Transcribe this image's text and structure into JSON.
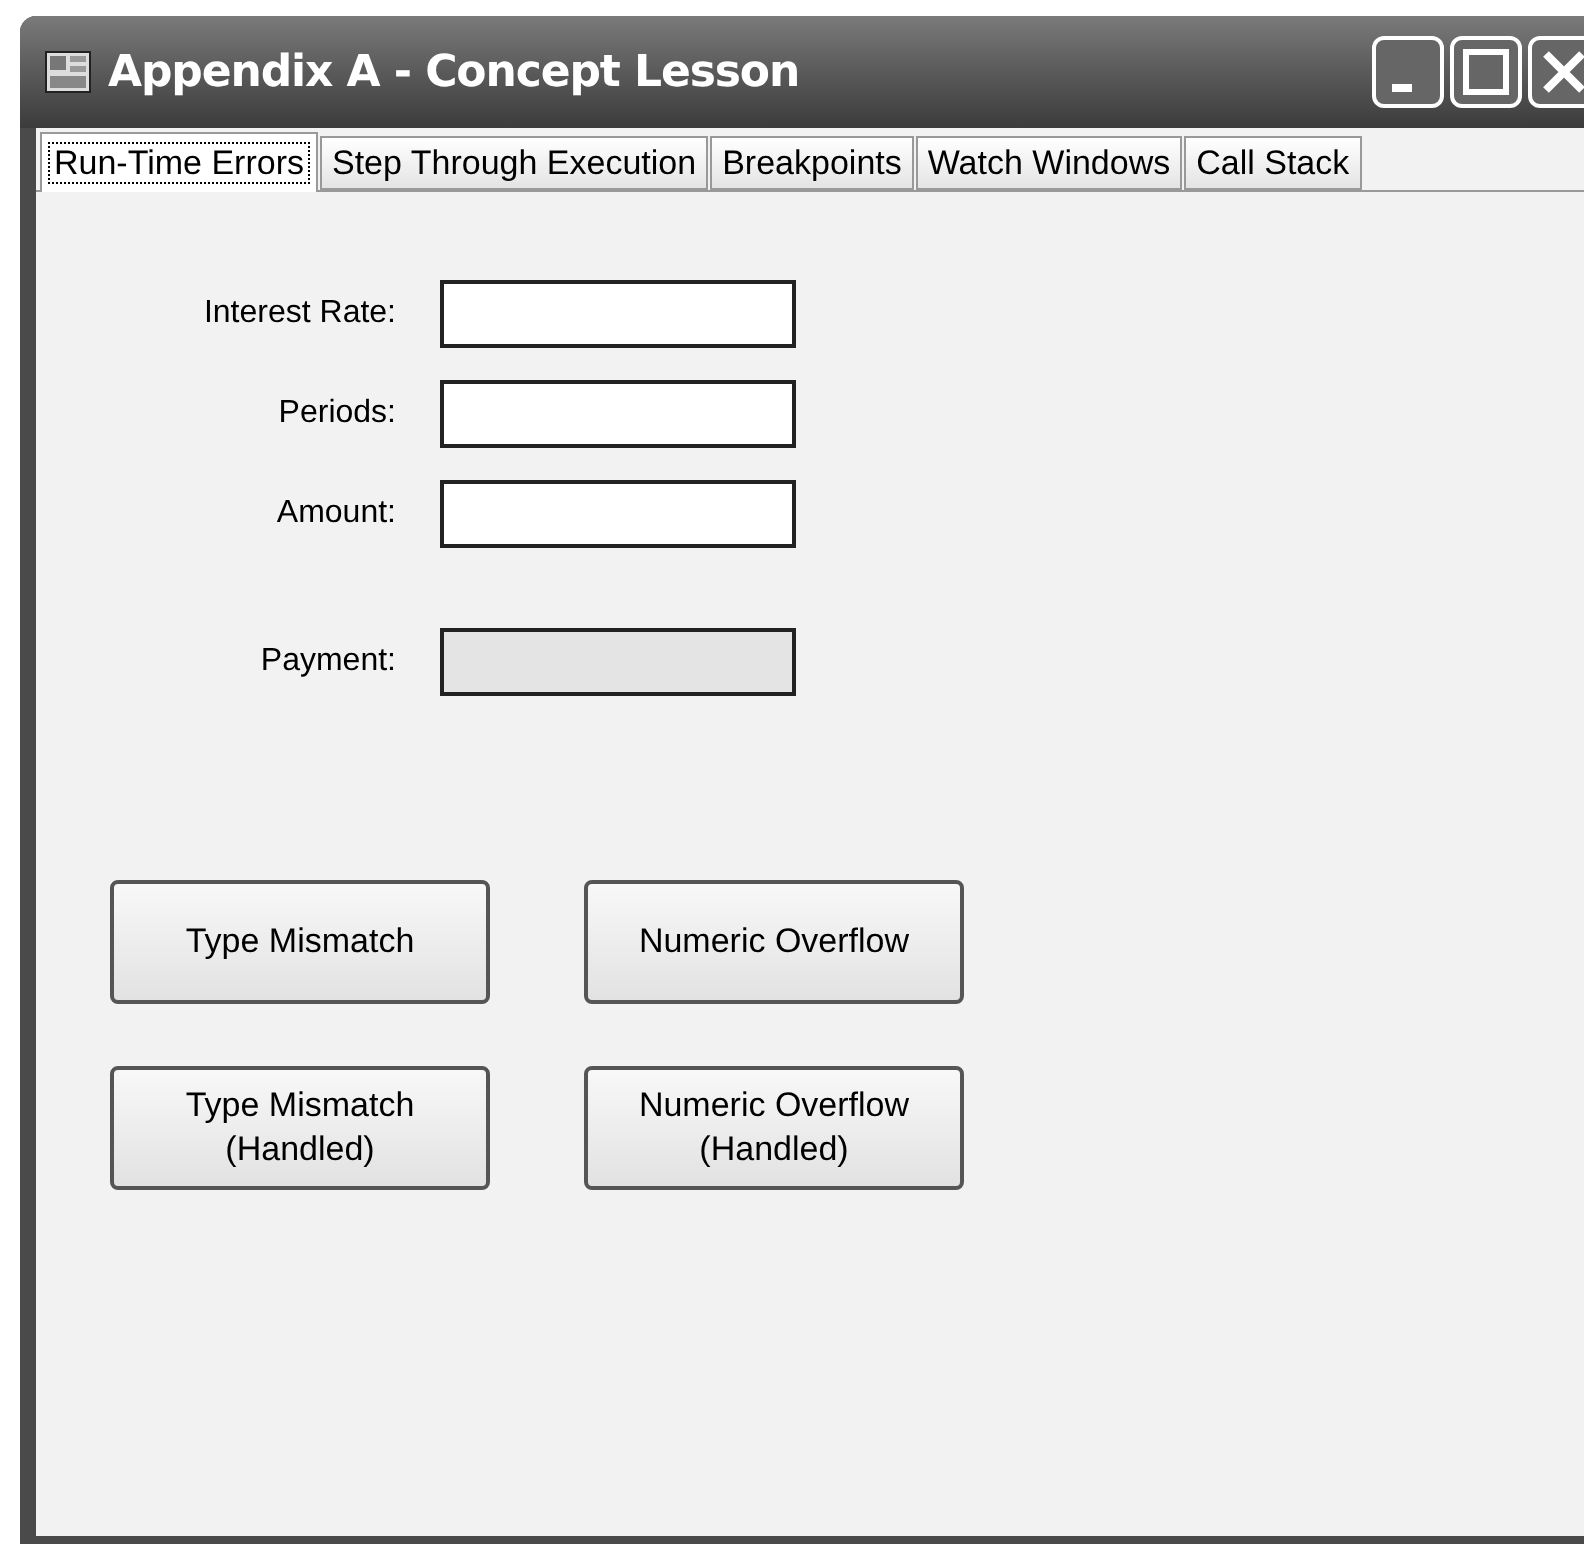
{
  "window": {
    "title": "Appendix A - Concept Lesson"
  },
  "tabs": [
    {
      "label": "Run-Time Errors",
      "selected": true
    },
    {
      "label": "Step Through Execution",
      "selected": false
    },
    {
      "label": "Breakpoints",
      "selected": false
    },
    {
      "label": "Watch Windows",
      "selected": false
    },
    {
      "label": "Call Stack",
      "selected": false
    }
  ],
  "fields": [
    {
      "label": "Interest Rate:",
      "disabled": false
    },
    {
      "label": "Periods:",
      "disabled": false
    },
    {
      "label": "Amount:",
      "disabled": false
    },
    {
      "label": "Payment:",
      "disabled": true
    }
  ],
  "buttons": [
    {
      "lines": [
        "Type Mismatch"
      ]
    },
    {
      "lines": [
        "Numeric Overflow"
      ]
    },
    {
      "lines": [
        "Type Mismatch",
        "(Handled)"
      ]
    },
    {
      "lines": [
        "Numeric Overflow",
        "(Handled)"
      ]
    }
  ]
}
